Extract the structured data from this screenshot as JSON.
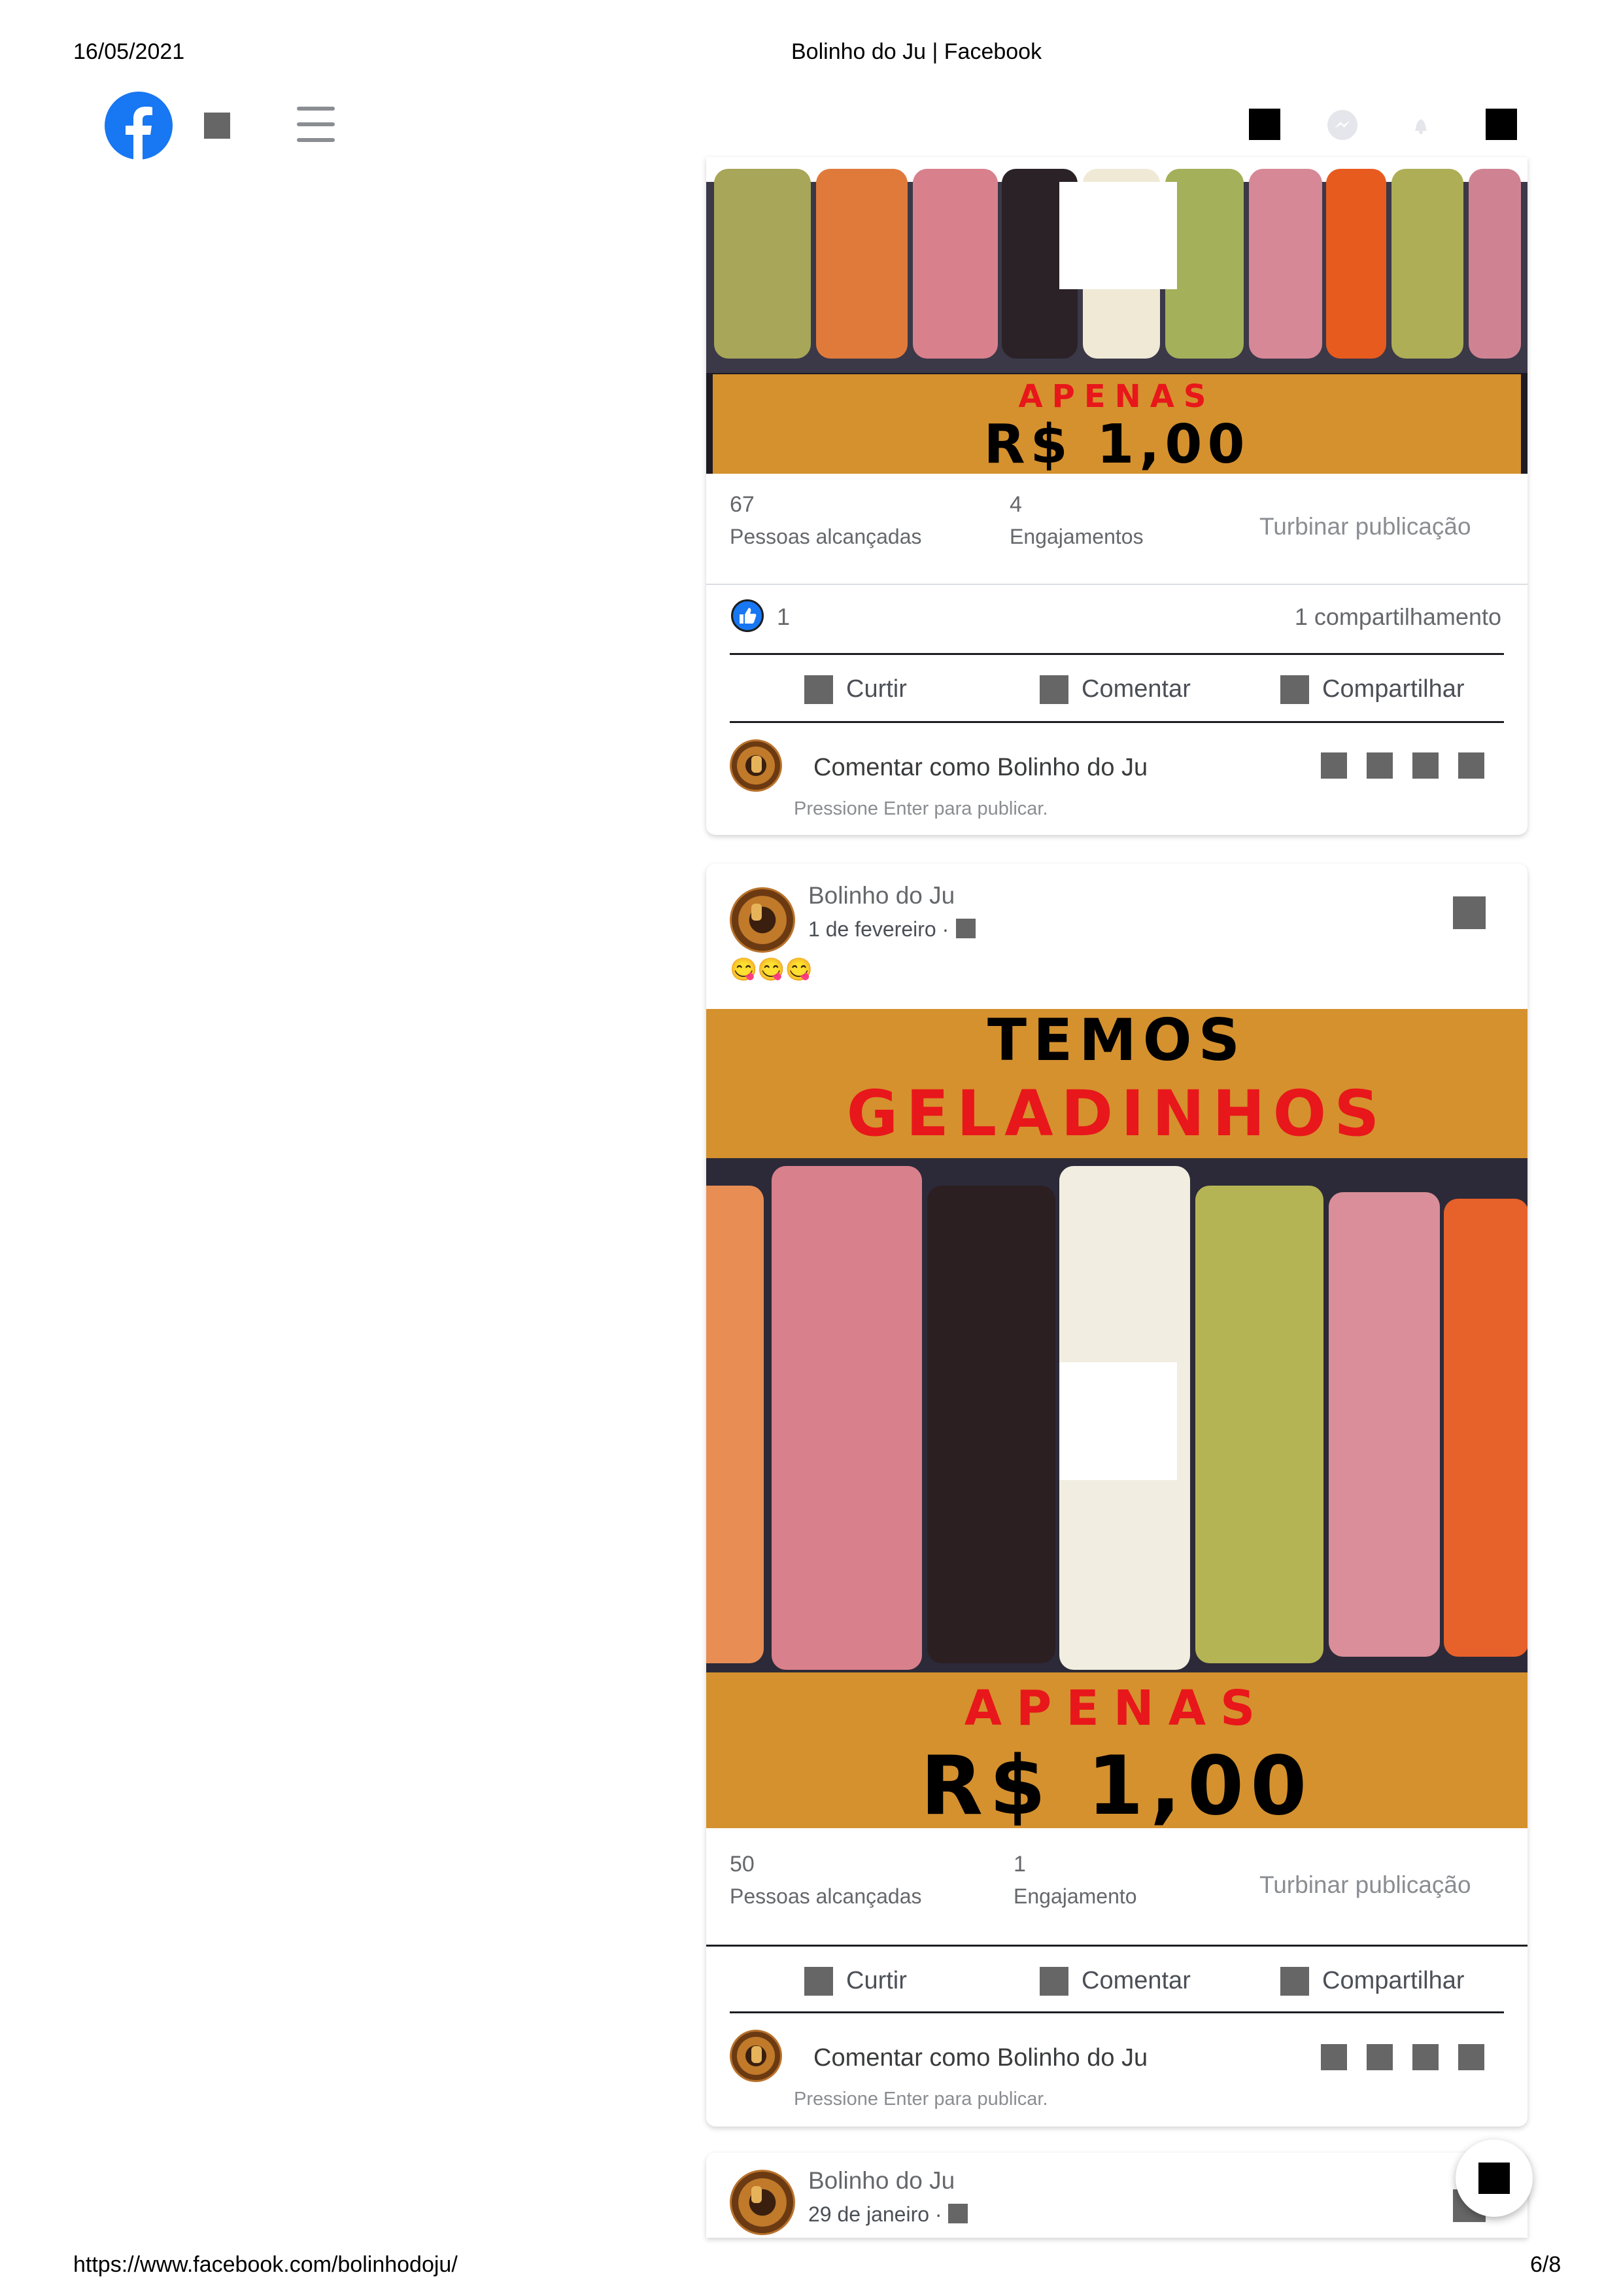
{
  "print_header": {
    "date": "16/05/2021",
    "title": "Bolinho do Ju | Facebook"
  },
  "print_footer": {
    "url": "https://www.facebook.com/bolinhodoju/",
    "page": "6/8"
  },
  "colors": {
    "facebook_blue": "#1877f2",
    "banner_orange": "#d5912e",
    "banner_red": "#e8171b"
  },
  "nav": {
    "icons": [
      "facebook-logo",
      "square-icon",
      "menu-icon",
      "square-icon",
      "messenger-icon",
      "bell-icon",
      "square-icon"
    ]
  },
  "post1": {
    "image": {
      "apenas": "APENAS",
      "price": "R$ 1,00"
    },
    "stats": {
      "reach_value": "67",
      "reach_label": "Pessoas alcançadas",
      "engagement_value": "4",
      "engagement_label": "Engajamentos",
      "boost_label": "Turbinar publicação"
    },
    "reactions_count": "1",
    "shares": "1 compartilhamento",
    "actions": {
      "like": "Curtir",
      "comment": "Comentar",
      "share": "Compartilhar"
    },
    "comment_placeholder": "Comentar como Bolinho do Ju",
    "comment_hint": "Pressione Enter para publicar."
  },
  "post2": {
    "author": "Bolinho do Ju",
    "date": "1 de fevereiro ·",
    "text": "😋😋😋",
    "image": {
      "temos": "TEMOS",
      "geladinhos": "GELADINHOS",
      "apenas": "APENAS",
      "price": "R$ 1,00"
    },
    "stats": {
      "reach_value": "50",
      "reach_label": "Pessoas alcançadas",
      "engagement_value": "1",
      "engagement_label": "Engajamento",
      "boost_label": "Turbinar publicação"
    },
    "actions": {
      "like": "Curtir",
      "comment": "Comentar",
      "share": "Compartilhar"
    },
    "comment_placeholder": "Comentar como Bolinho do Ju",
    "comment_hint": "Pressione Enter para publicar."
  },
  "post3": {
    "author": "Bolinho do Ju",
    "date": "29 de janeiro ·"
  }
}
